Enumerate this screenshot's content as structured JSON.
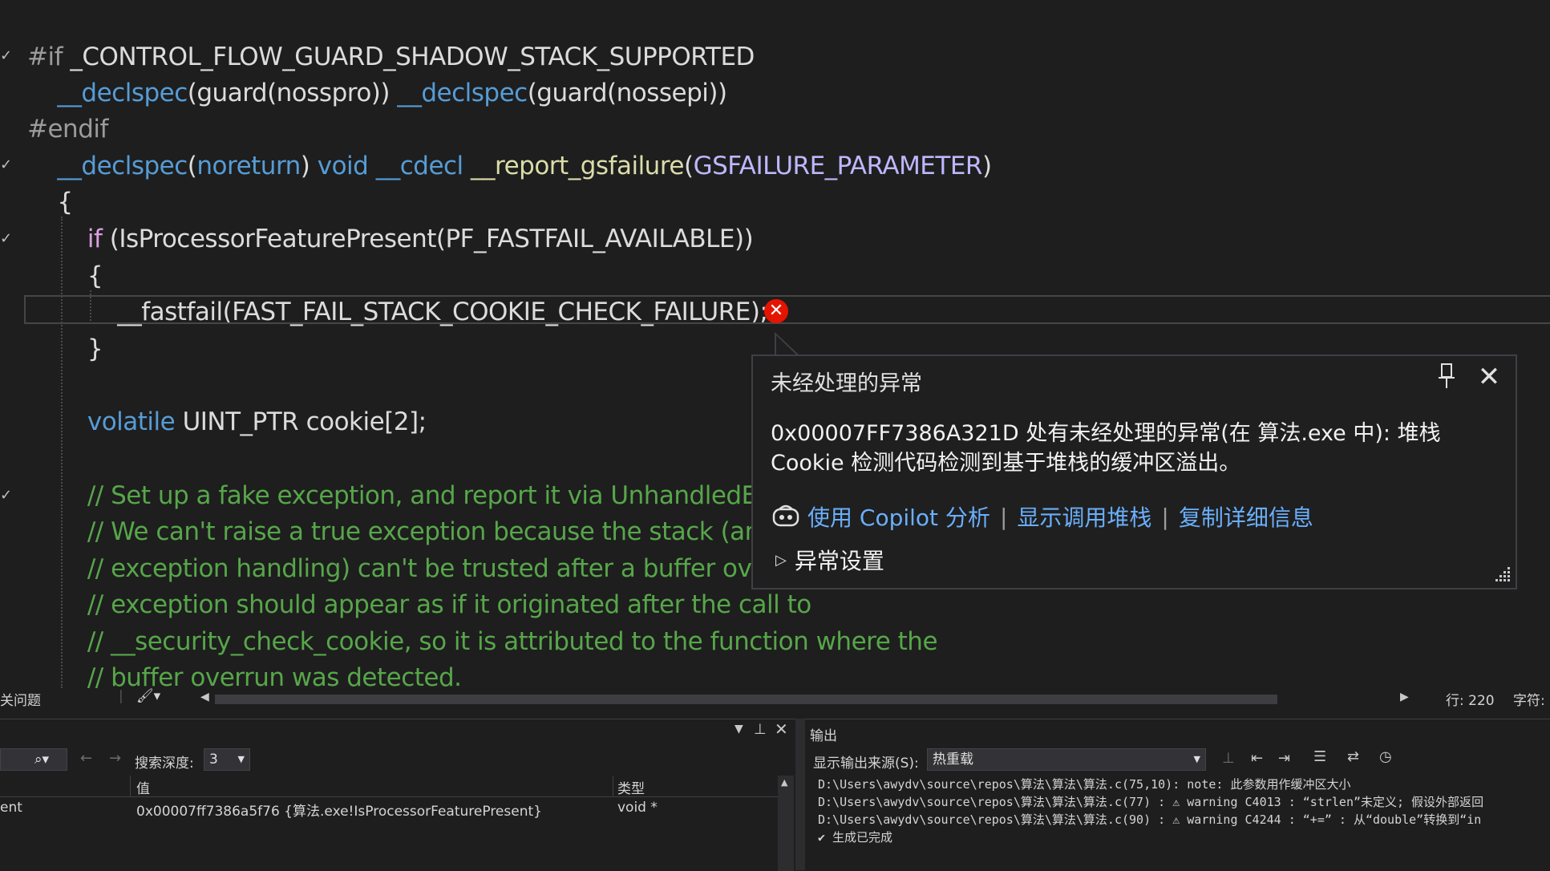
{
  "code": {
    "lines": [
      {
        "parts": [
          {
            "t": "#if ",
            "c": "c-pre"
          },
          {
            "t": "_CONTROL_FLOW_GUARD_SHADOW_STACK_SUPPORTED",
            "c": "c-ident"
          }
        ]
      },
      {
        "parts": [
          {
            "t": "    ",
            "c": ""
          },
          {
            "t": "__declspec",
            "c": "c-kw"
          },
          {
            "t": "(guard(nosspro)) ",
            "c": "c-ident"
          },
          {
            "t": "__declspec",
            "c": "c-kw"
          },
          {
            "t": "(guard(nossepi))",
            "c": "c-ident"
          }
        ]
      },
      {
        "parts": [
          {
            "t": "#endif",
            "c": "c-pre"
          }
        ]
      },
      {
        "parts": [
          {
            "t": "    ",
            "c": ""
          },
          {
            "t": "__declspec",
            "c": "c-kw"
          },
          {
            "t": "(",
            "c": "c-ident"
          },
          {
            "t": "noreturn",
            "c": "c-kw"
          },
          {
            "t": ") ",
            "c": "c-ident"
          },
          {
            "t": "void",
            "c": "c-kw"
          },
          {
            "t": " ",
            "c": ""
          },
          {
            "t": "__cdecl",
            "c": "c-kw"
          },
          {
            "t": " ",
            "c": ""
          },
          {
            "t": "__report_gsfailure",
            "c": "c-fn"
          },
          {
            "t": "(",
            "c": "c-ident"
          },
          {
            "t": "GSFAILURE_PARAMETER",
            "c": "c-macro"
          },
          {
            "t": ")",
            "c": "c-ident"
          }
        ]
      },
      {
        "parts": [
          {
            "t": "    {",
            "c": "c-ident"
          }
        ]
      },
      {
        "parts": [
          {
            "t": "        ",
            "c": ""
          },
          {
            "t": "if",
            "c": "c-ctl"
          },
          {
            "t": " (IsProcessorFeaturePresent(PF_FASTFAIL_AVAILABLE))",
            "c": "c-ident"
          }
        ]
      },
      {
        "parts": [
          {
            "t": "        {",
            "c": "c-ident"
          }
        ]
      },
      {
        "parts": [
          {
            "t": "            __fastfail(FAST_FAIL_STACK_COOKIE_CHECK_FAILURE);",
            "c": "c-ident"
          }
        ]
      },
      {
        "parts": [
          {
            "t": "        }",
            "c": "c-ident"
          }
        ]
      },
      {
        "parts": [
          {
            "t": "",
            "c": ""
          }
        ]
      },
      {
        "parts": [
          {
            "t": "        ",
            "c": ""
          },
          {
            "t": "volatile",
            "c": "c-kw"
          },
          {
            "t": " UINT_PTR ",
            "c": "c-ident"
          },
          {
            "t": "cookie",
            "c": "c-ident"
          },
          {
            "t": "[2];",
            "c": "c-ident"
          }
        ]
      },
      {
        "parts": [
          {
            "t": "",
            "c": ""
          }
        ]
      },
      {
        "parts": [
          {
            "t": "        // Set up a fake exception, and report it via UnhandledExce",
            "c": "c-cm"
          }
        ]
      },
      {
        "parts": [
          {
            "t": "        // We can't raise a true exception because the stack (and th",
            "c": "c-cm"
          }
        ]
      },
      {
        "parts": [
          {
            "t": "        // exception handling) can't be trusted after a buffer overru",
            "c": "c-cm"
          }
        ]
      },
      {
        "parts": [
          {
            "t": "        // exception should appear as if it originated after the call to",
            "c": "c-cm"
          }
        ]
      },
      {
        "parts": [
          {
            "t": "        // __security_check_cookie, so it is attributed to the function where the",
            "c": "c-cm"
          }
        ]
      },
      {
        "parts": [
          {
            "t": "        // buffer overrun was detected.",
            "c": "c-cm"
          }
        ]
      }
    ]
  },
  "popup": {
    "title": "未经处理的异常",
    "message": "0x00007FF7386A321D 处有未经处理的异常(在 算法.exe 中): 堆栈 Cookie 检测代码检测到基于堆栈的缓冲区溢出。",
    "link_copilot": "使用 Copilot 分析",
    "link_callstack": "显示调用堆栈",
    "link_copy": "复制详细信息",
    "separator": "|",
    "settings": "异常设置"
  },
  "status": {
    "issues": "关问题",
    "line": "行: 220",
    "char": "字符:"
  },
  "autos": {
    "depth_label": "搜索深度:",
    "depth_value": "3",
    "col_value": "值",
    "col_type": "类型",
    "row_name": "ent",
    "row_value": "0x00007ff7386a5f76 {算法.exe!IsProcessorFeaturePresent}",
    "row_type": "void *"
  },
  "output": {
    "title": "输出",
    "source_label": "显示输出来源(S):",
    "source_value": "热重载",
    "lines": [
      "D:\\Users\\awydv\\source\\repos\\算法\\算法\\算法.c(75,10): note: 此参数用作缓冲区大小",
      "D:\\Users\\awydv\\source\\repos\\算法\\算法\\算法.c(77) : ⚠ warning C4013 : “strlen”未定义; 假设外部返回",
      "D:\\Users\\awydv\\source\\repos\\算法\\算法\\算法.c(90) : ⚠ warning C4244 : “+=” : 从“double”转换到“in",
      "✔ 生成已完成"
    ]
  }
}
